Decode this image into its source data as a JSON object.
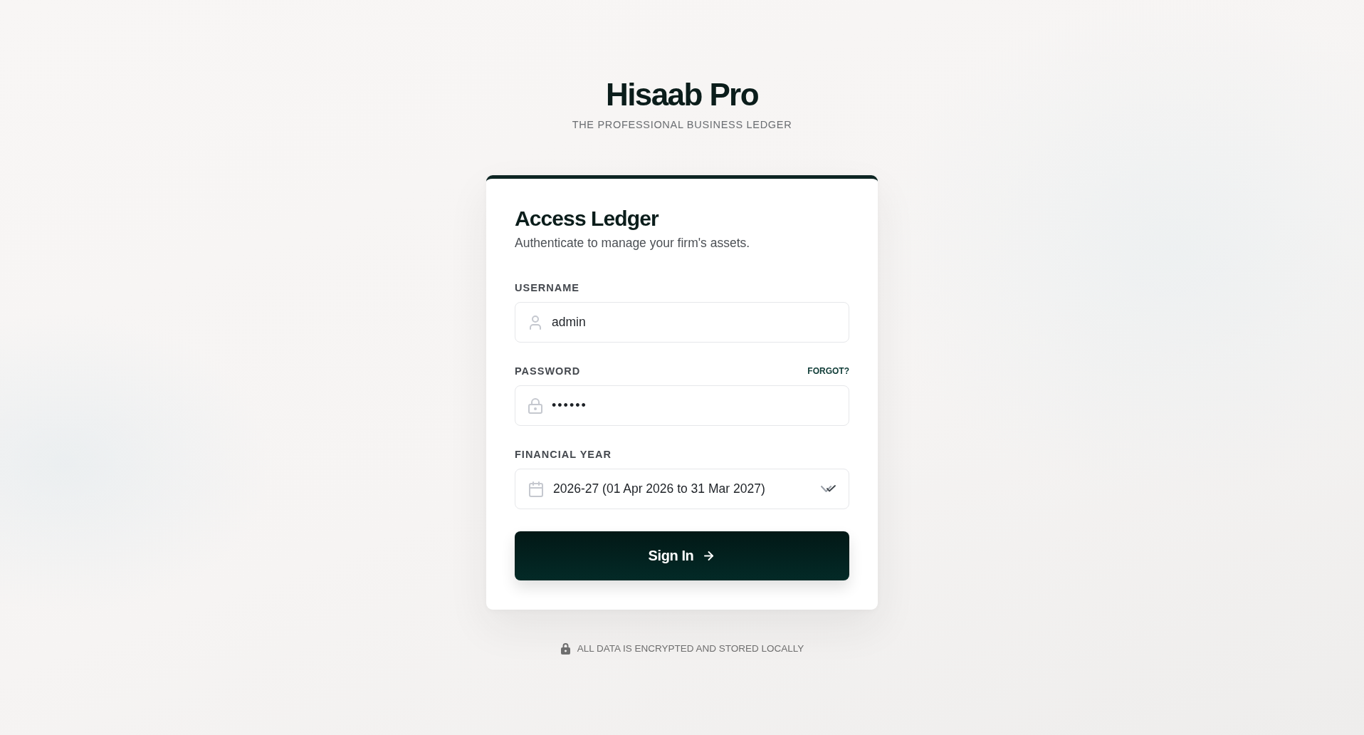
{
  "brand": {
    "title": "Hisaab Pro",
    "tagline": "THE PROFESSIONAL BUSINESS LEDGER"
  },
  "card": {
    "title": "Access Ledger",
    "subtitle": "Authenticate to manage your firm's assets.",
    "fields": [
      {
        "kind": "text",
        "label": "USERNAME",
        "value": "admin"
      },
      {
        "kind": "password",
        "label": "PASSWORD",
        "value": "••••••",
        "link": "FORGOT?"
      },
      {
        "kind": "select",
        "label": "FINANCIAL YEAR",
        "value": "2026-27 (01 Apr 2026 to 31 Mar 2027)"
      }
    ],
    "submit": {
      "label": "Sign In"
    }
  },
  "footer": {
    "text": "ALL DATA IS ENCRYPTED AND STORED LOCALLY"
  }
}
